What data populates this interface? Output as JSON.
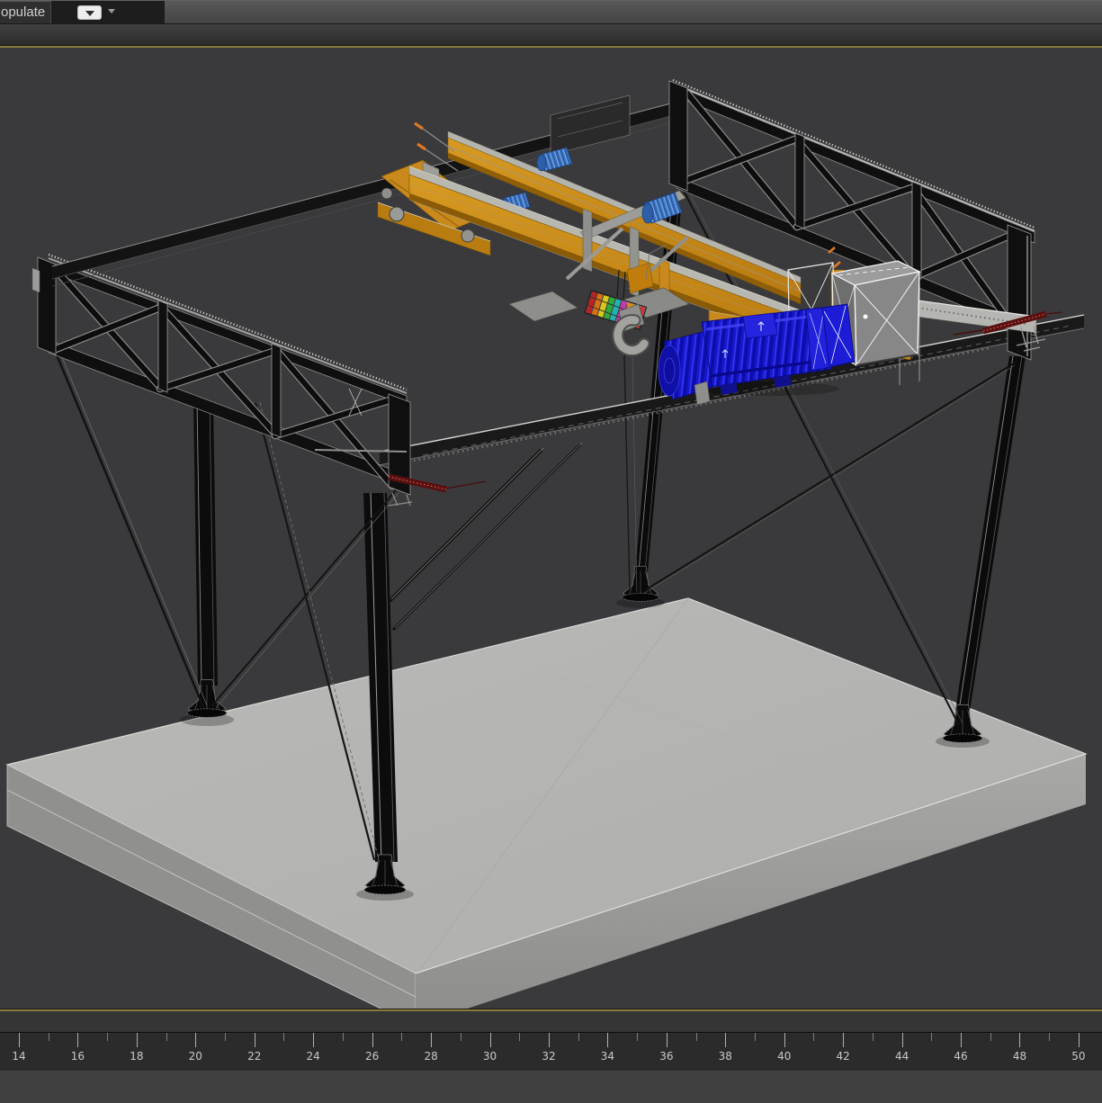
{
  "ribbon": {
    "tab_label": "opulate",
    "flyout_icon": "panel-flyout-arrow",
    "dropdown_icon": "caret-down"
  },
  "viewport": {
    "type": "3d-perspective-viewport",
    "shading": "shaded-with-edged-faces"
  },
  "timeline": {
    "start": 14,
    "end": 50,
    "minor_step": 1,
    "label_step": 2,
    "labels": [
      "14",
      "16",
      "18",
      "20",
      "22",
      "24",
      "26",
      "28",
      "30",
      "32",
      "34",
      "36",
      "38",
      "40",
      "42",
      "44",
      "46",
      "48",
      "50"
    ]
  },
  "colors": {
    "background": "#3a3a3c",
    "chrome_dark": "#1d1d1d",
    "viewport_border": "#8a7a3a",
    "trackbar_bg": "#353535",
    "ruler_bg": "#2b2b2b",
    "ruler_tick": "#b0b0b0",
    "ruler_tick_minor": "#7d7d7d",
    "ruler_text": "#c9c9c9",
    "bottom_strip": "#404040"
  },
  "scene": {
    "description": "Gantry crane 3D model standing on a concrete slab, shaded with wireframe edges",
    "objects": [
      {
        "name": "concrete-slab",
        "color": "#b4b4b2"
      },
      {
        "name": "gantry-legs",
        "count": 4,
        "color": "#0c0c0c"
      },
      {
        "name": "left-side-truss",
        "color": "#101010"
      },
      {
        "name": "right-side-truss",
        "color": "#101010"
      },
      {
        "name": "back-tie-beam",
        "color": "#131313"
      },
      {
        "name": "front-runway-beam",
        "color": "#191919"
      },
      {
        "name": "bridge-girders",
        "color": "#c9891c"
      },
      {
        "name": "hoist-trolley",
        "color": "#9a9a96"
      },
      {
        "name": "hoist-motor",
        "color": "#1818d0"
      },
      {
        "name": "buffer-cylinders",
        "color": "#3f76c4"
      },
      {
        "name": "electrical-cabinet",
        "color": "#878787"
      },
      {
        "name": "hook-block-sheaves",
        "color": "rainbow"
      },
      {
        "name": "hook",
        "color": "#a2a29e"
      },
      {
        "name": "end-stop-rails",
        "color": "#5c0f0f"
      },
      {
        "name": "bracing-cables",
        "color": "#161616"
      }
    ]
  }
}
